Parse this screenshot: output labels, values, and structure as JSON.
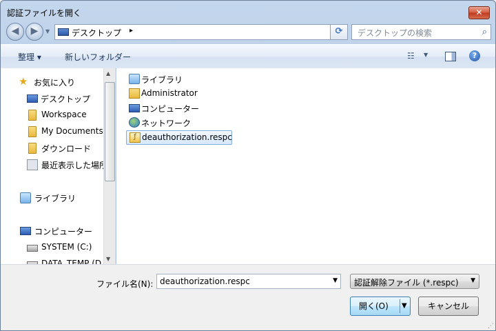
{
  "window": {
    "title": "認証ファイルを開く",
    "close_glyph": "✕"
  },
  "nav": {
    "back_glyph": "◀",
    "forward_glyph": "▶",
    "history_glyph": "▼",
    "address": "デスクトップ",
    "address_arrow": "▸",
    "address_drop": "▼",
    "refresh_glyph": "⟳",
    "search_placeholder": "デスクトップの検索",
    "search_glyph": "⌕"
  },
  "toolbar": {
    "organize": "整理 ▾",
    "new_folder": "新しいフォルダー",
    "views_glyph": "☷",
    "views_drop": "▼",
    "help": "?"
  },
  "tree": {
    "items": [
      {
        "label": "お気に入り",
        "icon": "star-icon"
      },
      {
        "label": "デスクトップ",
        "icon": "desktop-icon"
      },
      {
        "label": "Workspace",
        "icon": "folder-icon"
      },
      {
        "label": "My Documents",
        "icon": "folder-icon"
      },
      {
        "label": "ダウンロード",
        "icon": "download-folder-icon"
      },
      {
        "label": "最近表示した場所",
        "icon": "recent-places-icon"
      },
      {
        "label": "ライブラリ",
        "icon": "library-icon"
      },
      {
        "label": "コンピューター",
        "icon": "computer-icon"
      },
      {
        "label": "SYSTEM (C:)",
        "icon": "drive-icon"
      },
      {
        "label": "DATA_TEMP (D",
        "icon": "drive-icon"
      }
    ],
    "scroll_up": "▲",
    "scroll_down": "▼"
  },
  "files": {
    "items": [
      {
        "label": "ライブラリ",
        "icon": "library-icon"
      },
      {
        "label": "Administrator",
        "icon": "user-folder-icon"
      },
      {
        "label": "コンピューター",
        "icon": "computer-icon"
      },
      {
        "label": "ネットワーク",
        "icon": "network-icon"
      },
      {
        "label": "deauthorization.respc",
        "icon": "respc-file-icon",
        "selected": true
      }
    ]
  },
  "bottom": {
    "filename_label": "ファイル名(N):",
    "filename_value": "deauthorization.respc",
    "filename_drop": "▼",
    "filetype_value": "認証解除ファイル (*.respc)",
    "filetype_drop": "▼",
    "open_label": "開く(O)",
    "open_drop": "▼",
    "cancel_label": "キャンセル",
    "grip": "⋰"
  }
}
